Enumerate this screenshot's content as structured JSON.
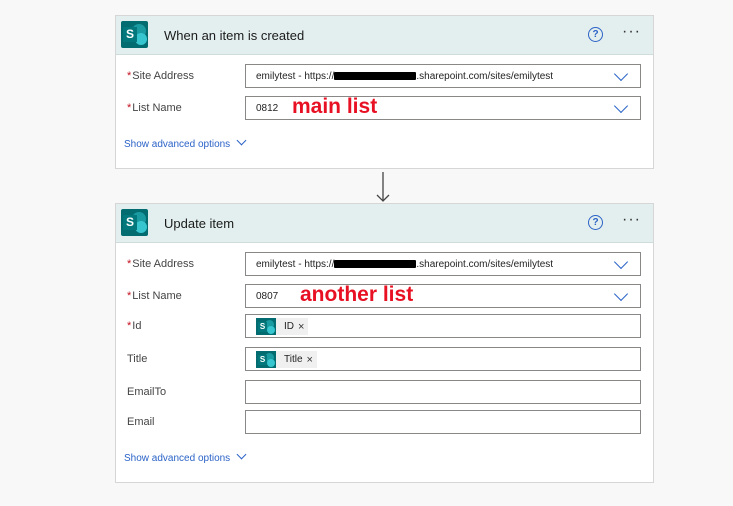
{
  "trigger": {
    "title": "When an item is created",
    "site_label": "Site Address",
    "site_prefix": "emilytest - https://",
    "site_suffix": ".sharepoint.com/sites/emilytest",
    "list_label": "List Name",
    "list_value": "0812",
    "list_annotation": "main list",
    "advanced_label": "Show advanced options"
  },
  "action": {
    "title": "Update item",
    "site_label": "Site Address",
    "site_prefix": "emilytest - https://",
    "site_suffix": ".sharepoint.com/sites/emilytest",
    "list_label": "List Name",
    "list_value": "0807",
    "list_annotation": "another list",
    "id_label": "Id",
    "id_token": "ID",
    "title_label": "Title",
    "title_token": "Title",
    "emailto_label": "EmailTo",
    "email_label": "Email",
    "advanced_label": "Show advanced options"
  },
  "icons": {
    "connector": "sharepoint-icon",
    "help": "question-circle-icon",
    "more": "ellipsis-icon",
    "dropdown": "chevron-down-icon",
    "connector_arrow": "down-arrow-icon"
  },
  "colors": {
    "header_bg": "#e3eeee",
    "link": "#2b63c7",
    "annotation": "#e81123",
    "required": "#c50f1f",
    "sharepoint": "#036c70"
  },
  "token_remove_glyph": "×",
  "help_glyph": "?",
  "more_glyph": "···",
  "required_mark": "*",
  "sp_letter": "S"
}
